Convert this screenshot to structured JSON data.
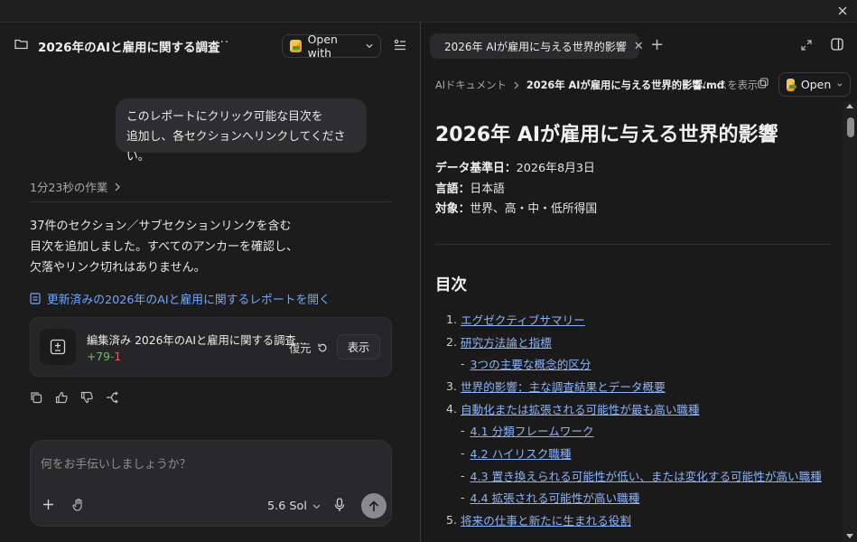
{
  "left": {
    "title": "2026年のAIと雇用に関する調査",
    "open_with_label": "Open with",
    "user_message_line1": "このレポートにクリック可能な目次を",
    "user_message_line2": "追加し、各セクションへリンクしてください。",
    "work_duration": "1分23秒の作業",
    "answer_line1": "37件のセクション／サブセクションリンクを含む",
    "answer_line2": "目次を追加しました。すべてのアンカーを確認し、",
    "answer_line3": "欠落やリンク切れはありません。",
    "open_report_link": "更新済みの2026年のAIと雇用に関するレポートを開く",
    "edit_card": {
      "title": "編集済み 2026年のAIと雇用に関する調査...",
      "added": "+79",
      "removed": "-1",
      "restore_label": "復元",
      "show_label": "表示"
    },
    "composer": {
      "placeholder": "何をお手伝いしましょうか？",
      "model": "5.6 Sol"
    }
  },
  "right": {
    "tab_title": "2026年 AIが雇用に与える世界的影響",
    "breadcrumb_root": "AIドキュメント",
    "breadcrumb_file": "2026年 AIが雇用に与える世界的影響.md",
    "show_source": "ソースを表示",
    "open_label": "Open",
    "doc_title": "2026年 AIが雇用に与える世界的影響",
    "meta": [
      {
        "label": "データ基準日：",
        "value": "2026年8月3日"
      },
      {
        "label": "言語：",
        "value": "日本語"
      },
      {
        "label": "対象：",
        "value": "世界、高・中・低所得国"
      }
    ],
    "toc_heading": "目次",
    "toc": [
      {
        "num": "1.",
        "text": "エグゼクティブサマリー",
        "sub": false
      },
      {
        "num": "2.",
        "text": "研究方法論と指標",
        "sub": false
      },
      {
        "num": "-",
        "text": "3つの主要な概念的区分",
        "sub": true
      },
      {
        "num": "3.",
        "text": "世界的影響：主な調査結果とデータ概要",
        "sub": false
      },
      {
        "num": "4.",
        "text": "自動化または拡張される可能性が最も高い職種",
        "sub": false
      },
      {
        "num": "-",
        "text": "4.1 分類フレームワーク",
        "sub": true
      },
      {
        "num": "-",
        "text": "4.2 ハイリスク職種",
        "sub": true
      },
      {
        "num": "-",
        "text": "4.3 置き換えられる可能性が低い、または変化する可能性が高い職種",
        "sub": true
      },
      {
        "num": "-",
        "text": "4.4 拡張される可能性が高い職種",
        "sub": true
      },
      {
        "num": "5.",
        "text": "将来の仕事と新たに生まれる役割",
        "sub": false
      }
    ]
  },
  "colors": {
    "link": "#8ab4f8",
    "accent_link": "#6ea7ff",
    "added": "#6bbf6b",
    "removed": "#e06060"
  }
}
